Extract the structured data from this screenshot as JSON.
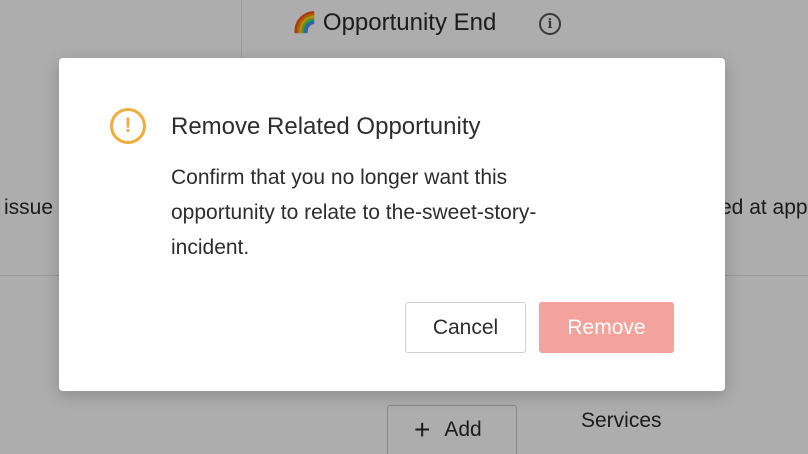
{
  "background": {
    "heading_emoji": "🌈",
    "heading_title": "Opportunity End",
    "info_icon": "i",
    "left_text": "issue",
    "right_text": "ed at app",
    "add_button_label": "Add",
    "services_label": "Services"
  },
  "modal": {
    "icon": "warning-circle-icon",
    "icon_glyph": "!",
    "title": "Remove Related Opportunity",
    "body": "Confirm that you no longer want this opportunity to relate to the-sweet-story-incident.",
    "cancel_label": "Cancel",
    "remove_label": "Remove"
  },
  "colors": {
    "warning": "#f0ad3c",
    "remove_button": "#f4a39c",
    "overlay": "rgba(0,0,0,0.32)"
  }
}
